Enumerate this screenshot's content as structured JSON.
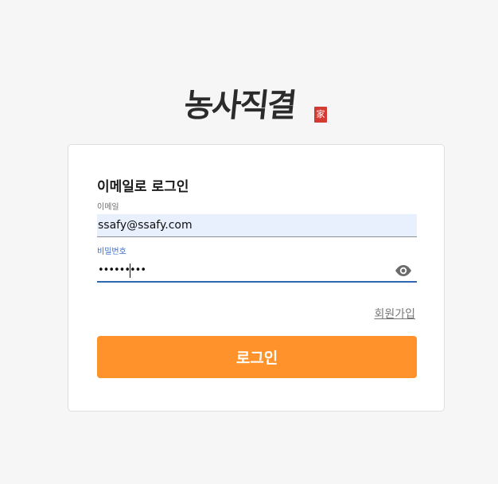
{
  "logo": {
    "text": "농사직결",
    "seal": "家"
  },
  "login_form": {
    "title": "이메일로 로그인",
    "email": {
      "label": "이메일",
      "value": "ssafy@ssafy.com"
    },
    "password": {
      "label": "비밀번호",
      "value": "•••••••••",
      "toggle_icon": "eye-icon"
    },
    "signup_link": "회원가입",
    "login_button": "로그인"
  },
  "colors": {
    "accent": "#ff922b",
    "focus": "#3066b0",
    "autofill": "#e8f0fe"
  }
}
